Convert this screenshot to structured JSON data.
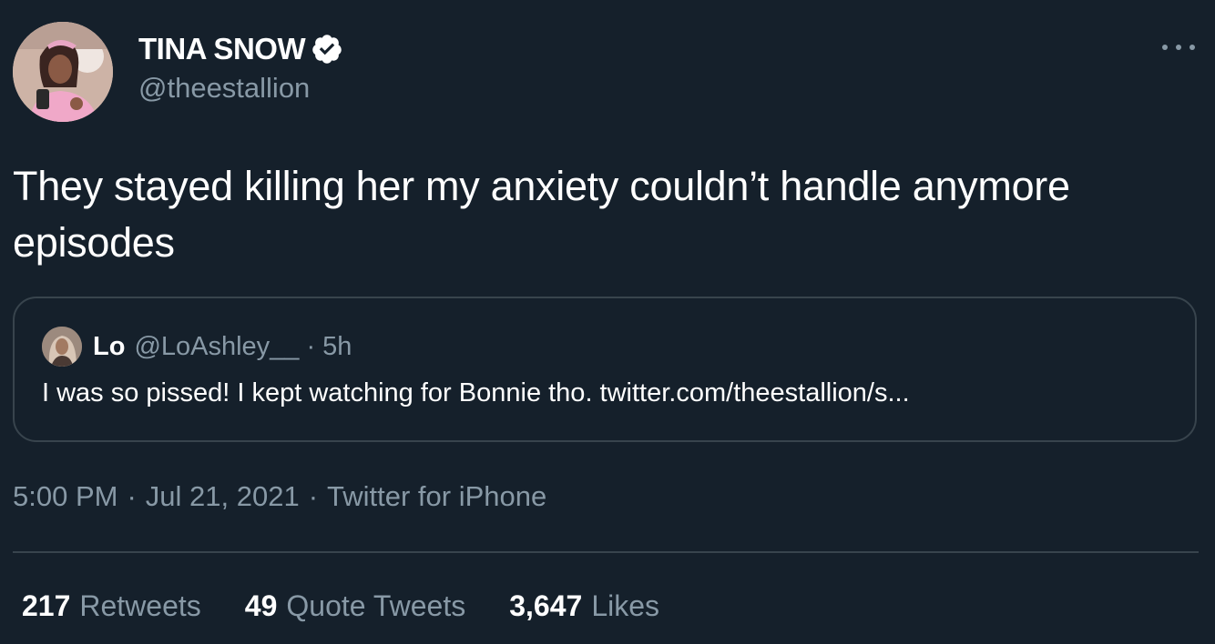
{
  "author": {
    "display_name": "TINA SNOW",
    "handle": "@theestallion",
    "verified_icon": "verified-badge-icon",
    "avatar_icon": "profile-photo"
  },
  "tweet": {
    "text": "They stayed killing her my anxiety couldn’t handle anymore episodes"
  },
  "quoted_tweet": {
    "name": "Lo",
    "handle": "@LoAshley__",
    "separator": "·",
    "time": "5h",
    "text": "I was so pissed! I kept watching for Bonnie tho. twitter.com/theestallion/s..."
  },
  "meta": {
    "time": "5:00 PM",
    "date": "Jul 21, 2021",
    "source": "Twitter for iPhone",
    "separator": "·"
  },
  "stats": {
    "retweets": {
      "count": "217",
      "label": "Retweets"
    },
    "quotes": {
      "count": "49",
      "label": "Quote Tweets"
    },
    "likes": {
      "count": "3,647",
      "label": "Likes"
    }
  },
  "colors": {
    "background": "#15202b",
    "secondary_text": "#8899a6",
    "border": "#38444d",
    "verified_badge": "#ffffff"
  },
  "icons": {
    "more": "more-options-icon"
  }
}
